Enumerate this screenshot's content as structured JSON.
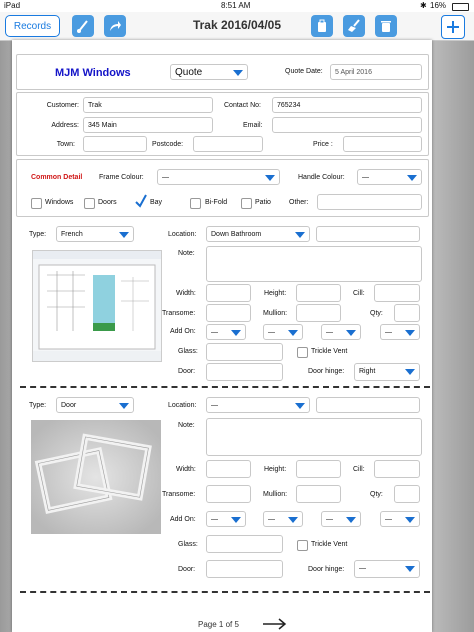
{
  "status_bar": {
    "carrier": "iPad",
    "time": "8:51 AM",
    "battery": "16%"
  },
  "toolbar": {
    "records_label": "Records",
    "title": "Trak 2016/04/05",
    "icons": [
      "brush-icon",
      "share-icon",
      "clipboard-icon",
      "broom-icon",
      "trash-icon",
      "add-icon"
    ]
  },
  "header": {
    "company": "MJM Windows",
    "doc_type": "Quote",
    "quote_date_label": "Quote Date:",
    "quote_date": "5 April 2016"
  },
  "customer": {
    "customer_label": "Customer:",
    "customer_value": "Trak",
    "contact_label": "Contact No:",
    "contact_value": "765234",
    "address_label": "Address:",
    "address_value": "345 Main",
    "email_label": "Email:",
    "email_value": "",
    "town_label": "Town:",
    "postcode_label": "Postcode:",
    "price_label": "Price :"
  },
  "common": {
    "title": "Common Detail",
    "frame_colour_label": "Frame Colour:",
    "frame_colour_value": "—",
    "handle_colour_label": "Handle Colour:",
    "handle_colour_value": "—",
    "types": [
      {
        "label": "Windows",
        "checked": false
      },
      {
        "label": "Doors",
        "checked": false
      },
      {
        "label": "Bay",
        "checked": true
      },
      {
        "label": "Bi-Fold",
        "checked": false
      },
      {
        "label": "Patio",
        "checked": false
      }
    ],
    "other_label": "Other:"
  },
  "items": [
    {
      "type_label": "Type:",
      "type_value": "French",
      "location_label": "Location:",
      "location_value": "Down Bathroom",
      "note_label": "Note:",
      "width_label": "Width:",
      "height_label": "Height:",
      "cill_label": "Cill:",
      "transome_label": "Transome:",
      "mullion_label": "Mullion:",
      "qty_label": "Qty:",
      "addon_label": "Add On:",
      "addon_values": [
        "—",
        "—",
        "—",
        "—"
      ],
      "glass_label": "Glass:",
      "trickle_label": "Trickle Vent",
      "door_label": "Door:",
      "door_hinge_label": "Door hinge:",
      "door_hinge_value": "Right"
    },
    {
      "type_label": "Type:",
      "type_value": "Door",
      "location_label": "Location:",
      "location_value": "—",
      "note_label": "Note:",
      "width_label": "Width:",
      "height_label": "Height:",
      "cill_label": "Cill:",
      "transome_label": "Transome:",
      "mullion_label": "Mullion:",
      "qty_label": "Qty:",
      "addon_label": "Add On:",
      "addon_values": [
        "—",
        "—",
        "—",
        "—"
      ],
      "glass_label": "Glass:",
      "trickle_label": "Trickle Vent",
      "door_label": "Door:",
      "door_hinge_label": "Door hinge:",
      "door_hinge_value": "—"
    }
  ],
  "footer": {
    "page_label": "Page 1 of 5"
  },
  "colors": {
    "accent": "#1a7be0",
    "company": "#1414c8",
    "section_title": "#d01818"
  }
}
